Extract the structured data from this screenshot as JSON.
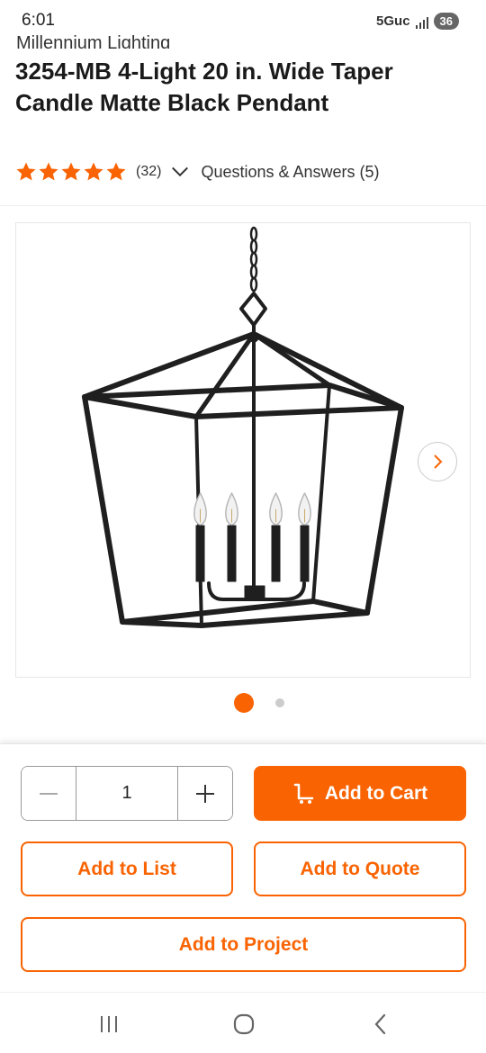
{
  "status_bar": {
    "time": "6:01",
    "network": "5Guc",
    "battery": "36"
  },
  "product": {
    "brand": "Millennium Lighting",
    "title": "3254-MB 4-Light 20 in. Wide Taper Candle Matte Black Pendant",
    "rating_stars": 5,
    "review_count": "(32)",
    "qa_label": "Questions & Answers (5)"
  },
  "gallery": {
    "image_icon": "pendant-lantern-image",
    "next_icon": "chevron-right-icon",
    "total_images": 2,
    "active_index": 0
  },
  "actions": {
    "quantity": "1",
    "add_to_cart": "Add to Cart",
    "add_to_list": "Add to List",
    "add_to_quote": "Add to Quote",
    "add_to_project": "Add to Project"
  },
  "nav": {
    "recents_icon": "recents-icon",
    "home_icon": "home-icon",
    "back_icon": "back-icon"
  },
  "colors": {
    "accent": "#f96302",
    "text": "#222222"
  }
}
